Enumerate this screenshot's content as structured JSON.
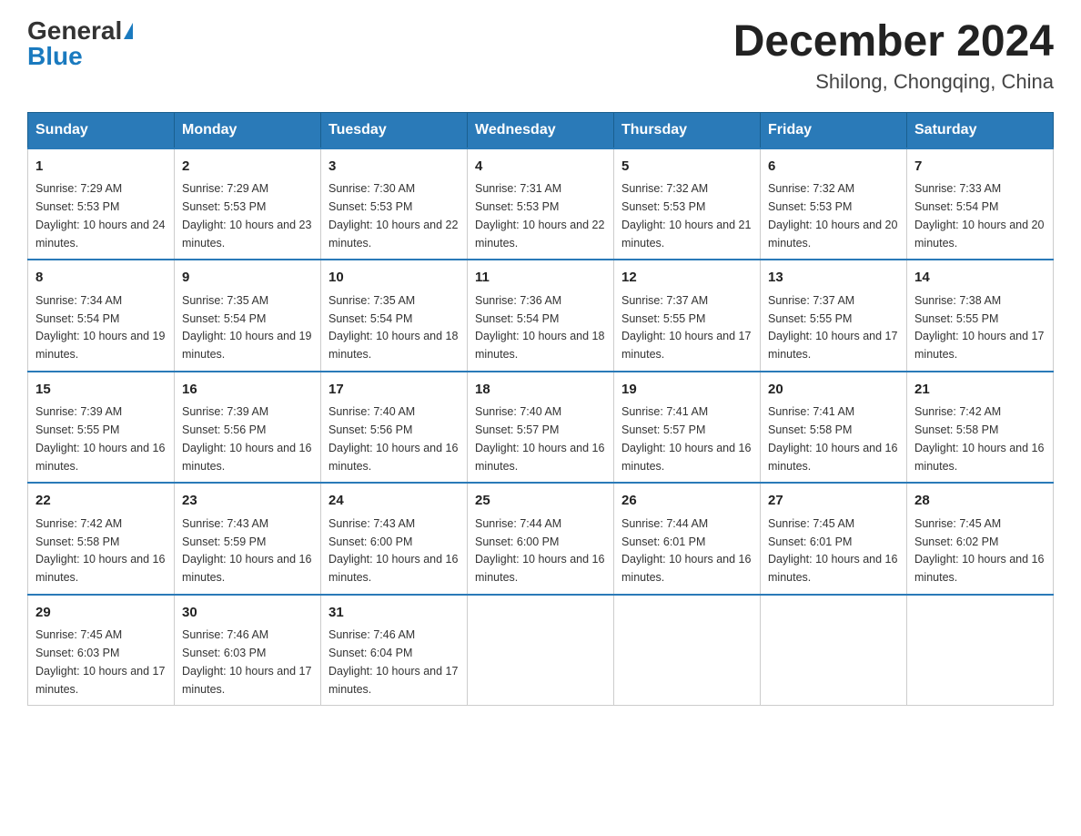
{
  "logo": {
    "general": "General",
    "blue": "Blue"
  },
  "header": {
    "month_title": "December 2024",
    "location": "Shilong, Chongqing, China"
  },
  "days_of_week": [
    "Sunday",
    "Monday",
    "Tuesday",
    "Wednesday",
    "Thursday",
    "Friday",
    "Saturday"
  ],
  "weeks": [
    [
      {
        "day": "1",
        "sunrise": "7:29 AM",
        "sunset": "5:53 PM",
        "daylight": "10 hours and 24 minutes."
      },
      {
        "day": "2",
        "sunrise": "7:29 AM",
        "sunset": "5:53 PM",
        "daylight": "10 hours and 23 minutes."
      },
      {
        "day": "3",
        "sunrise": "7:30 AM",
        "sunset": "5:53 PM",
        "daylight": "10 hours and 22 minutes."
      },
      {
        "day": "4",
        "sunrise": "7:31 AM",
        "sunset": "5:53 PM",
        "daylight": "10 hours and 22 minutes."
      },
      {
        "day": "5",
        "sunrise": "7:32 AM",
        "sunset": "5:53 PM",
        "daylight": "10 hours and 21 minutes."
      },
      {
        "day": "6",
        "sunrise": "7:32 AM",
        "sunset": "5:53 PM",
        "daylight": "10 hours and 20 minutes."
      },
      {
        "day": "7",
        "sunrise": "7:33 AM",
        "sunset": "5:54 PM",
        "daylight": "10 hours and 20 minutes."
      }
    ],
    [
      {
        "day": "8",
        "sunrise": "7:34 AM",
        "sunset": "5:54 PM",
        "daylight": "10 hours and 19 minutes."
      },
      {
        "day": "9",
        "sunrise": "7:35 AM",
        "sunset": "5:54 PM",
        "daylight": "10 hours and 19 minutes."
      },
      {
        "day": "10",
        "sunrise": "7:35 AM",
        "sunset": "5:54 PM",
        "daylight": "10 hours and 18 minutes."
      },
      {
        "day": "11",
        "sunrise": "7:36 AM",
        "sunset": "5:54 PM",
        "daylight": "10 hours and 18 minutes."
      },
      {
        "day": "12",
        "sunrise": "7:37 AM",
        "sunset": "5:55 PM",
        "daylight": "10 hours and 17 minutes."
      },
      {
        "day": "13",
        "sunrise": "7:37 AM",
        "sunset": "5:55 PM",
        "daylight": "10 hours and 17 minutes."
      },
      {
        "day": "14",
        "sunrise": "7:38 AM",
        "sunset": "5:55 PM",
        "daylight": "10 hours and 17 minutes."
      }
    ],
    [
      {
        "day": "15",
        "sunrise": "7:39 AM",
        "sunset": "5:55 PM",
        "daylight": "10 hours and 16 minutes."
      },
      {
        "day": "16",
        "sunrise": "7:39 AM",
        "sunset": "5:56 PM",
        "daylight": "10 hours and 16 minutes."
      },
      {
        "day": "17",
        "sunrise": "7:40 AM",
        "sunset": "5:56 PM",
        "daylight": "10 hours and 16 minutes."
      },
      {
        "day": "18",
        "sunrise": "7:40 AM",
        "sunset": "5:57 PM",
        "daylight": "10 hours and 16 minutes."
      },
      {
        "day": "19",
        "sunrise": "7:41 AM",
        "sunset": "5:57 PM",
        "daylight": "10 hours and 16 minutes."
      },
      {
        "day": "20",
        "sunrise": "7:41 AM",
        "sunset": "5:58 PM",
        "daylight": "10 hours and 16 minutes."
      },
      {
        "day": "21",
        "sunrise": "7:42 AM",
        "sunset": "5:58 PM",
        "daylight": "10 hours and 16 minutes."
      }
    ],
    [
      {
        "day": "22",
        "sunrise": "7:42 AM",
        "sunset": "5:58 PM",
        "daylight": "10 hours and 16 minutes."
      },
      {
        "day": "23",
        "sunrise": "7:43 AM",
        "sunset": "5:59 PM",
        "daylight": "10 hours and 16 minutes."
      },
      {
        "day": "24",
        "sunrise": "7:43 AM",
        "sunset": "6:00 PM",
        "daylight": "10 hours and 16 minutes."
      },
      {
        "day": "25",
        "sunrise": "7:44 AM",
        "sunset": "6:00 PM",
        "daylight": "10 hours and 16 minutes."
      },
      {
        "day": "26",
        "sunrise": "7:44 AM",
        "sunset": "6:01 PM",
        "daylight": "10 hours and 16 minutes."
      },
      {
        "day": "27",
        "sunrise": "7:45 AM",
        "sunset": "6:01 PM",
        "daylight": "10 hours and 16 minutes."
      },
      {
        "day": "28",
        "sunrise": "7:45 AM",
        "sunset": "6:02 PM",
        "daylight": "10 hours and 16 minutes."
      }
    ],
    [
      {
        "day": "29",
        "sunrise": "7:45 AM",
        "sunset": "6:03 PM",
        "daylight": "10 hours and 17 minutes."
      },
      {
        "day": "30",
        "sunrise": "7:46 AM",
        "sunset": "6:03 PM",
        "daylight": "10 hours and 17 minutes."
      },
      {
        "day": "31",
        "sunrise": "7:46 AM",
        "sunset": "6:04 PM",
        "daylight": "10 hours and 17 minutes."
      },
      null,
      null,
      null,
      null
    ]
  ]
}
